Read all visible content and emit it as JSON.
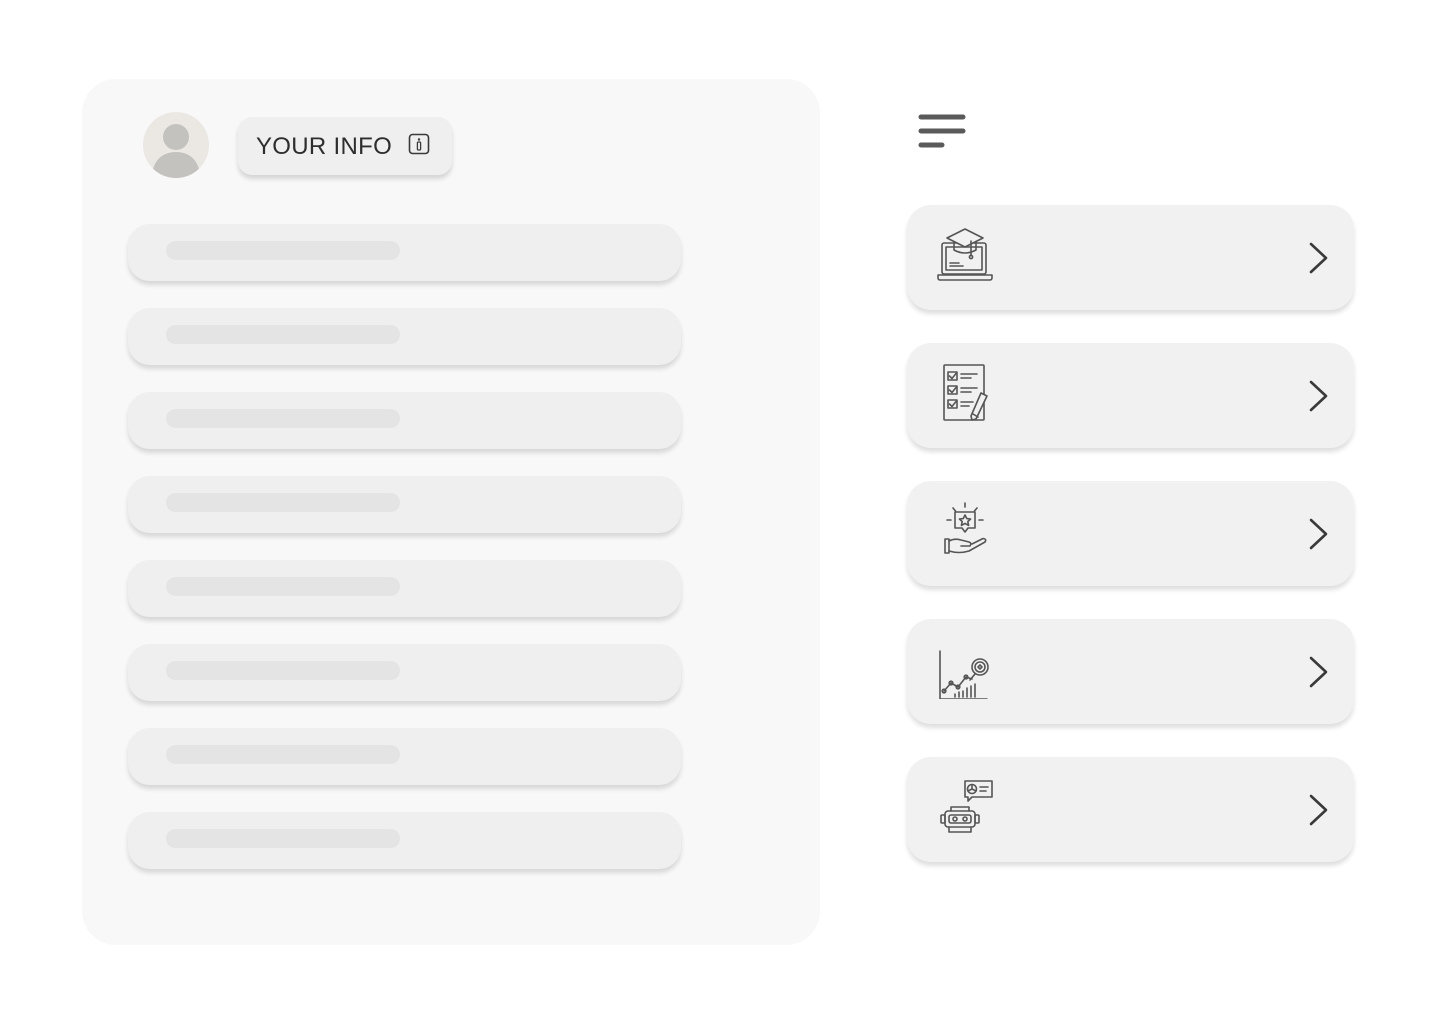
{
  "info_panel": {
    "title": "YOUR INFO",
    "avatar_icon": "user-avatar-icon",
    "info_icon": "info-icon",
    "field_count": 8
  },
  "menu_icon": "hamburger-menu-icon",
  "nav_items": [
    {
      "icon": "online-education-icon"
    },
    {
      "icon": "checklist-icon"
    },
    {
      "icon": "idea-hand-icon"
    },
    {
      "icon": "growth-analytics-icon"
    },
    {
      "icon": "robot-assistant-icon"
    }
  ],
  "colors": {
    "page_bg": "#ffffff",
    "card_bg": "#f8f8f8",
    "item_bg": "#efefef",
    "icon_stroke": "#555555",
    "text": "#2e2e2e"
  }
}
